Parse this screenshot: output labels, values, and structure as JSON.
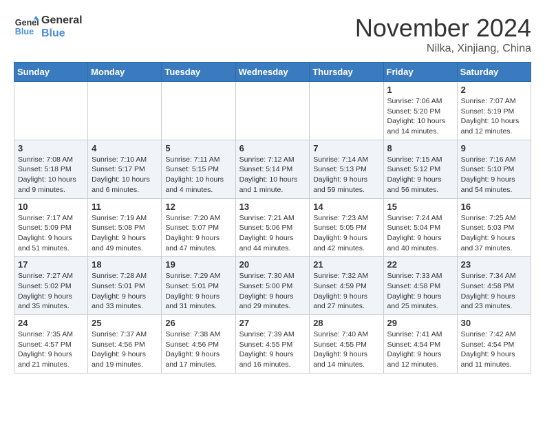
{
  "logo": {
    "line1": "General",
    "line2": "Blue"
  },
  "title": "November 2024",
  "location": "Nilka, Xinjiang, China",
  "weekdays": [
    "Sunday",
    "Monday",
    "Tuesday",
    "Wednesday",
    "Thursday",
    "Friday",
    "Saturday"
  ],
  "weeks": [
    [
      {
        "day": "",
        "info": ""
      },
      {
        "day": "",
        "info": ""
      },
      {
        "day": "",
        "info": ""
      },
      {
        "day": "",
        "info": ""
      },
      {
        "day": "",
        "info": ""
      },
      {
        "day": "1",
        "info": "Sunrise: 7:06 AM\nSunset: 5:20 PM\nDaylight: 10 hours and 14 minutes."
      },
      {
        "day": "2",
        "info": "Sunrise: 7:07 AM\nSunset: 5:19 PM\nDaylight: 10 hours and 12 minutes."
      }
    ],
    [
      {
        "day": "3",
        "info": "Sunrise: 7:08 AM\nSunset: 5:18 PM\nDaylight: 10 hours and 9 minutes."
      },
      {
        "day": "4",
        "info": "Sunrise: 7:10 AM\nSunset: 5:17 PM\nDaylight: 10 hours and 6 minutes."
      },
      {
        "day": "5",
        "info": "Sunrise: 7:11 AM\nSunset: 5:15 PM\nDaylight: 10 hours and 4 minutes."
      },
      {
        "day": "6",
        "info": "Sunrise: 7:12 AM\nSunset: 5:14 PM\nDaylight: 10 hours and 1 minute."
      },
      {
        "day": "7",
        "info": "Sunrise: 7:14 AM\nSunset: 5:13 PM\nDaylight: 9 hours and 59 minutes."
      },
      {
        "day": "8",
        "info": "Sunrise: 7:15 AM\nSunset: 5:12 PM\nDaylight: 9 hours and 56 minutes."
      },
      {
        "day": "9",
        "info": "Sunrise: 7:16 AM\nSunset: 5:10 PM\nDaylight: 9 hours and 54 minutes."
      }
    ],
    [
      {
        "day": "10",
        "info": "Sunrise: 7:17 AM\nSunset: 5:09 PM\nDaylight: 9 hours and 51 minutes."
      },
      {
        "day": "11",
        "info": "Sunrise: 7:19 AM\nSunset: 5:08 PM\nDaylight: 9 hours and 49 minutes."
      },
      {
        "day": "12",
        "info": "Sunrise: 7:20 AM\nSunset: 5:07 PM\nDaylight: 9 hours and 47 minutes."
      },
      {
        "day": "13",
        "info": "Sunrise: 7:21 AM\nSunset: 5:06 PM\nDaylight: 9 hours and 44 minutes."
      },
      {
        "day": "14",
        "info": "Sunrise: 7:23 AM\nSunset: 5:05 PM\nDaylight: 9 hours and 42 minutes."
      },
      {
        "day": "15",
        "info": "Sunrise: 7:24 AM\nSunset: 5:04 PM\nDaylight: 9 hours and 40 minutes."
      },
      {
        "day": "16",
        "info": "Sunrise: 7:25 AM\nSunset: 5:03 PM\nDaylight: 9 hours and 37 minutes."
      }
    ],
    [
      {
        "day": "17",
        "info": "Sunrise: 7:27 AM\nSunset: 5:02 PM\nDaylight: 9 hours and 35 minutes."
      },
      {
        "day": "18",
        "info": "Sunrise: 7:28 AM\nSunset: 5:01 PM\nDaylight: 9 hours and 33 minutes."
      },
      {
        "day": "19",
        "info": "Sunrise: 7:29 AM\nSunset: 5:01 PM\nDaylight: 9 hours and 31 minutes."
      },
      {
        "day": "20",
        "info": "Sunrise: 7:30 AM\nSunset: 5:00 PM\nDaylight: 9 hours and 29 minutes."
      },
      {
        "day": "21",
        "info": "Sunrise: 7:32 AM\nSunset: 4:59 PM\nDaylight: 9 hours and 27 minutes."
      },
      {
        "day": "22",
        "info": "Sunrise: 7:33 AM\nSunset: 4:58 PM\nDaylight: 9 hours and 25 minutes."
      },
      {
        "day": "23",
        "info": "Sunrise: 7:34 AM\nSunset: 4:58 PM\nDaylight: 9 hours and 23 minutes."
      }
    ],
    [
      {
        "day": "24",
        "info": "Sunrise: 7:35 AM\nSunset: 4:57 PM\nDaylight: 9 hours and 21 minutes."
      },
      {
        "day": "25",
        "info": "Sunrise: 7:37 AM\nSunset: 4:56 PM\nDaylight: 9 hours and 19 minutes."
      },
      {
        "day": "26",
        "info": "Sunrise: 7:38 AM\nSunset: 4:56 PM\nDaylight: 9 hours and 17 minutes."
      },
      {
        "day": "27",
        "info": "Sunrise: 7:39 AM\nSunset: 4:55 PM\nDaylight: 9 hours and 16 minutes."
      },
      {
        "day": "28",
        "info": "Sunrise: 7:40 AM\nSunset: 4:55 PM\nDaylight: 9 hours and 14 minutes."
      },
      {
        "day": "29",
        "info": "Sunrise: 7:41 AM\nSunset: 4:54 PM\nDaylight: 9 hours and 12 minutes."
      },
      {
        "day": "30",
        "info": "Sunrise: 7:42 AM\nSunset: 4:54 PM\nDaylight: 9 hours and 11 minutes."
      }
    ]
  ]
}
